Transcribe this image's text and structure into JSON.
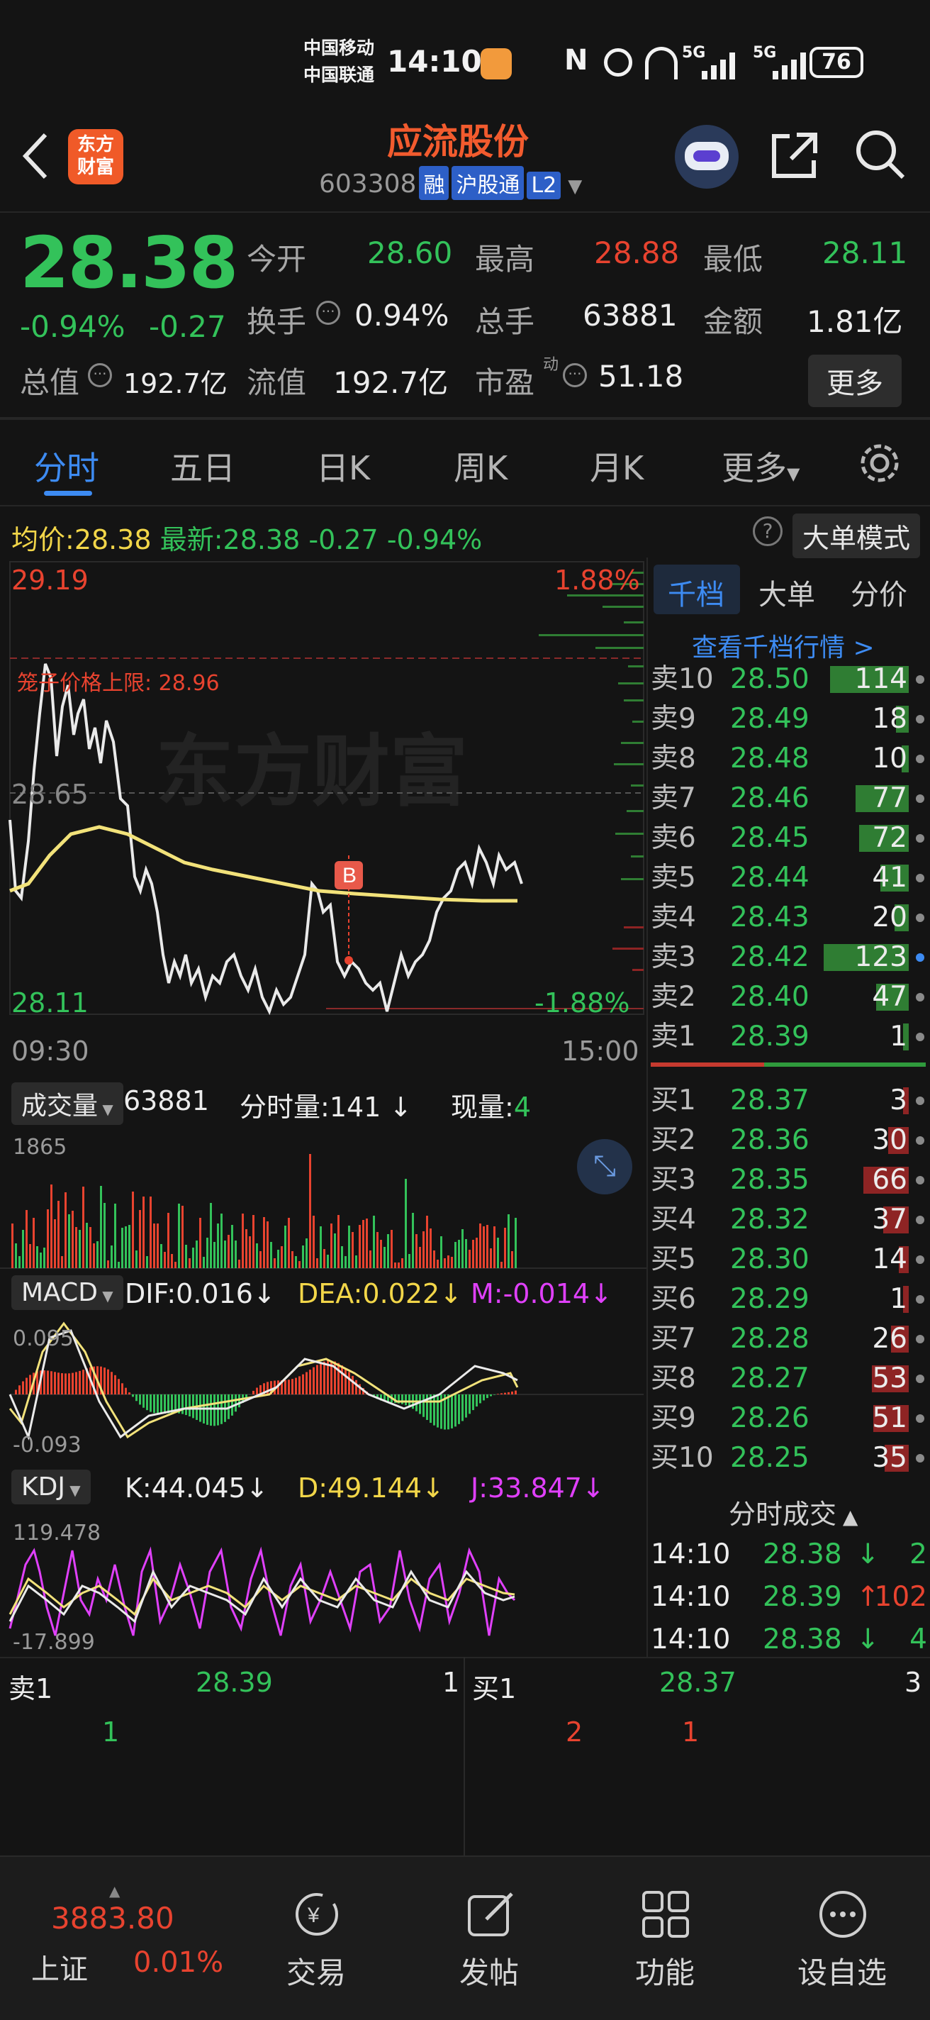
{
  "status": {
    "carrier1": "中国移动",
    "carrier2": "中国联通",
    "time": "14:10",
    "net1": "5G",
    "net2": "5G",
    "battery": "76",
    "nfc": "N"
  },
  "header": {
    "back_icon": "chevron-left-icon",
    "logo_line1": "东方",
    "logo_line2": "财富",
    "title": "应流股份",
    "code": "603308",
    "tags": [
      "融",
      "沪股通",
      "L2"
    ]
  },
  "quote": {
    "price": "28.38",
    "change_pct": "-0.94%",
    "change": "-0.27",
    "open_label": "今开",
    "open": "28.60",
    "high_label": "最高",
    "high": "28.88",
    "low_label": "最低",
    "low": "28.11",
    "turnover_label": "换手",
    "turnover": "0.94%",
    "volume_label": "总手",
    "volume": "63881",
    "amount_label": "金额",
    "amount": "1.81亿",
    "mktcap_label": "总值",
    "mktcap": "192.7亿",
    "float_label": "流值",
    "float": "192.7亿",
    "pe_label": "市盈",
    "pe_sup": "动",
    "pe": "51.18",
    "more": "更多"
  },
  "tabs": [
    "分时",
    "五日",
    "日K",
    "周K",
    "月K",
    "更多"
  ],
  "chart": {
    "avg_label": "均价:",
    "avg": "28.38",
    "latest_label": "最新:",
    "latest": "28.38",
    "chg": "-0.27",
    "chg_pct": "-0.94%",
    "mode_btn": "大单模式",
    "top_price": "29.19",
    "top_pct": "1.88%",
    "limit_label": "笼子价格上限: 28.96",
    "mid_price": "28.65",
    "bot_price": "28.11",
    "bot_pct": "-1.88%",
    "t_start": "09:30",
    "t_end": "15:00",
    "marker": "B",
    "watermark": "东方财富"
  },
  "volume": {
    "label": "成交量",
    "total": "63881",
    "fen_label": "分时量:",
    "fen": "141",
    "now_label": "现量:",
    "now": "4",
    "max": "1865"
  },
  "macd": {
    "label": "MACD",
    "dif": "DIF:0.016",
    "dea": "DEA:0.022",
    "m": "M:-0.014",
    "top": "0.095",
    "bot": "-0.093"
  },
  "kdj": {
    "label": "KDJ",
    "k": "K:44.045",
    "d": "D:49.144",
    "j": "J:33.847",
    "top": "119.478",
    "bot": "-17.899"
  },
  "book": {
    "tabs": [
      "千档",
      "大单",
      "分价"
    ],
    "link": "查看千档行情 >",
    "asks": [
      [
        "卖10",
        "28.50",
        "114"
      ],
      [
        "卖9",
        "28.49",
        "18"
      ],
      [
        "卖8",
        "28.48",
        "10"
      ],
      [
        "卖7",
        "28.46",
        "77"
      ],
      [
        "卖6",
        "28.45",
        "72"
      ],
      [
        "卖5",
        "28.44",
        "41"
      ],
      [
        "卖4",
        "28.43",
        "20"
      ],
      [
        "卖3",
        "28.42",
        "123"
      ],
      [
        "卖2",
        "28.40",
        "47"
      ],
      [
        "卖1",
        "28.39",
        "1"
      ]
    ],
    "bids": [
      [
        "买1",
        "28.37",
        "3"
      ],
      [
        "买2",
        "28.36",
        "30"
      ],
      [
        "买3",
        "28.35",
        "66"
      ],
      [
        "买4",
        "28.32",
        "37"
      ],
      [
        "买5",
        "28.30",
        "14"
      ],
      [
        "买6",
        "28.29",
        "1"
      ],
      [
        "买7",
        "28.28",
        "26"
      ],
      [
        "买8",
        "28.27",
        "53"
      ],
      [
        "买9",
        "28.26",
        "51"
      ],
      [
        "买10",
        "28.25",
        "35"
      ]
    ],
    "trades_label": "分时成交",
    "trades": [
      [
        "14:10",
        "28.38",
        "↓",
        "2"
      ],
      [
        "14:10",
        "28.39",
        "↑",
        "102"
      ],
      [
        "14:10",
        "28.38",
        "↓",
        "4"
      ]
    ]
  },
  "strip": {
    "sell_label": "卖1",
    "sell_price": "28.39",
    "sell_qty": "1",
    "buy_label": "买1",
    "buy_price": "28.37",
    "buy_qty": "3",
    "q1": "1",
    "q2": "2",
    "q3": "1"
  },
  "nav": {
    "index_value": "3883.80",
    "index_name": "上证",
    "index_pct": "0.01%",
    "items": [
      "交易",
      "发帖",
      "功能",
      "设自选"
    ]
  }
}
